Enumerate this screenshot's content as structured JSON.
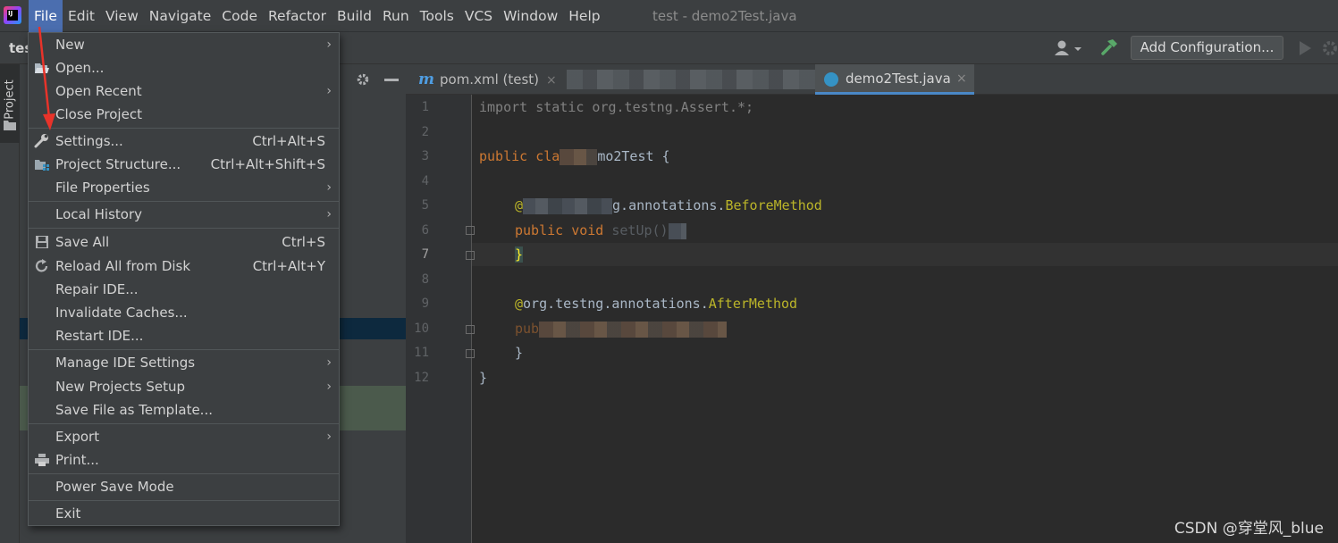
{
  "menubar": {
    "items": [
      "File",
      "Edit",
      "View",
      "Navigate",
      "Code",
      "Refactor",
      "Build",
      "Run",
      "Tools",
      "VCS",
      "Window",
      "Help"
    ],
    "window_title": "test - demo2Test.java"
  },
  "toolbar": {
    "breadcrumb_root": "tes",
    "add_configuration": "Add Configuration..."
  },
  "sidebar": {
    "project_tab": "Project"
  },
  "editor_tabs": {
    "pom": {
      "icon_letter": "m",
      "label": "pom.xml (test)",
      "close": "×"
    },
    "active": {
      "label": "demo2Test.java",
      "close": "×"
    }
  },
  "editor": {
    "line_numbers": [
      "1",
      "2",
      "3",
      "4",
      "5",
      "6",
      "7",
      "8",
      "9",
      "10",
      "11",
      "12"
    ],
    "current_line": 7,
    "lines": {
      "l1": "import static org.testng.Assert.*;",
      "l3_kw": "public cla",
      "l3_rest": "mo2Test {",
      "l5_head": "@",
      "l5_mid": "g.annotations.",
      "l5_ann": "BeforeMethod",
      "l6_kw": "public void",
      "l6_rest": "setUp()",
      "l7": "}",
      "l9_at": "@",
      "l9_mid": "org.testng.annotations.",
      "l9_ann": "AfterMethod",
      "l10_kw": "pub",
      "l11": "}",
      "l12": "}"
    }
  },
  "file_menu": {
    "new": "New",
    "open": "Open...",
    "open_recent": "Open Recent",
    "close_project": "Close Project",
    "settings": "Settings...",
    "settings_shortcut": "Ctrl+Alt+S",
    "project_structure": "Project Structure...",
    "project_structure_shortcut": "Ctrl+Alt+Shift+S",
    "file_properties": "File Properties",
    "local_history": "Local History",
    "save_all": "Save All",
    "save_all_shortcut": "Ctrl+S",
    "reload_all": "Reload All from Disk",
    "reload_all_shortcut": "Ctrl+Alt+Y",
    "repair_ide": "Repair IDE...",
    "invalidate_caches": "Invalidate Caches...",
    "restart_ide": "Restart IDE...",
    "manage_ide_settings": "Manage IDE Settings",
    "new_projects_setup": "New Projects Setup",
    "save_as_template": "Save File as Template...",
    "export": "Export",
    "print": "Print...",
    "power_save": "Power Save Mode",
    "exit": "Exit",
    "submenu_arrow": "›"
  },
  "watermark": "CSDN @穿堂风_blue",
  "colors": {
    "menu_active": "#4b6eaf",
    "editor_bg": "#2b2b2b",
    "keyword": "#cc7832",
    "annotation": "#bbb529",
    "arrow": "#e8332a"
  }
}
